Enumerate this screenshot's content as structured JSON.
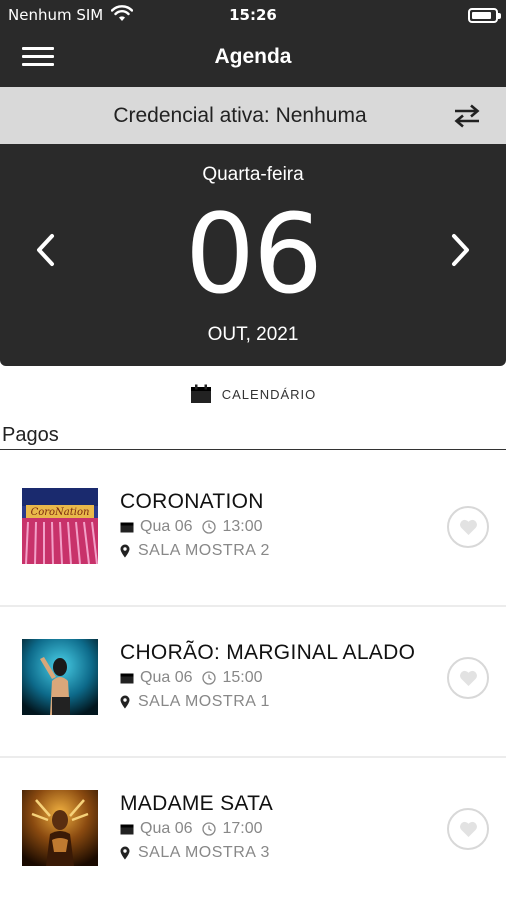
{
  "status_bar": {
    "carrier": "Nenhum SIM",
    "time": "15:26",
    "battery_level": 0.85
  },
  "header": {
    "title": "Agenda"
  },
  "credential": {
    "label": "Credencial ativa: Nenhuma"
  },
  "date": {
    "weekday": "Quarta-feira",
    "day": "06",
    "month_year": "OUT, 2021"
  },
  "calendar_link": {
    "label": "CALENDÁRIO"
  },
  "section": {
    "title": "Pagos"
  },
  "events": [
    {
      "title": "CORONATION",
      "date": "Qua 06",
      "time": "13:00",
      "venue": "SALA MOSTRA 2",
      "poster_text": "CoroNation"
    },
    {
      "title": "CHORÃO: MARGINAL ALADO",
      "date": "Qua 06",
      "time": "15:00",
      "venue": "SALA MOSTRA 1"
    },
    {
      "title": "MADAME SATA",
      "date": "Qua 06",
      "time": "17:00",
      "venue": "SALA MOSTRA 3"
    }
  ],
  "colors": {
    "header_bg": "#2a2a2a",
    "credential_bg": "#d9d9d9",
    "muted_text": "#888888"
  }
}
